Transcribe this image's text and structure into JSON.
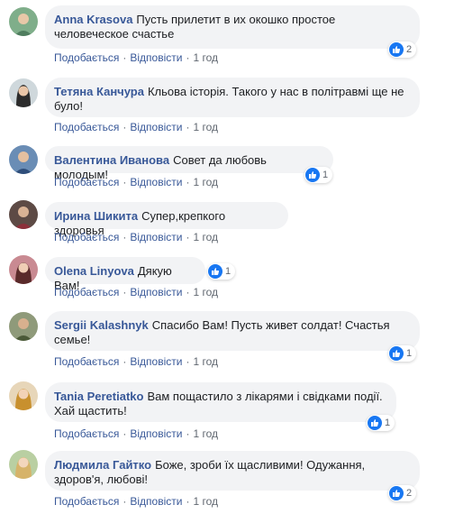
{
  "actions": {
    "like": "Подобається",
    "reply": "Відповісти",
    "separator": "·"
  },
  "colors": {
    "author": "#385898",
    "bubble": "#f2f3f5",
    "like": "#1877f2",
    "meta": "#606770"
  },
  "comments": [
    {
      "author": "Anna Krasova",
      "text": "Пусть прилетит в их окошко простое человеческое счастье",
      "time": "1 год",
      "likes": "2"
    },
    {
      "author": "Тетяна Канчура",
      "text": "Кльова історія. Такого у нас в політравмі ще не було!",
      "time": "1 год"
    },
    {
      "author": "Валентина Иванова",
      "text": "Совет да любовь молодым!",
      "time": "1 год",
      "likes": "1"
    },
    {
      "author": "Ирина Шикита",
      "text": "Супер,крепкого здоровья",
      "time": "1 год"
    },
    {
      "author": "Olena Linyova",
      "text": "Дякую Вам!",
      "time": "1 год",
      "likes": "1"
    },
    {
      "author": "Sergii Kalashnyk",
      "text": "Спасибо Вам! Пусть живет солдат! Счастья семье!",
      "time": "1 год",
      "likes": "1"
    },
    {
      "author": "Tania Peretiatko",
      "text": "Вам пощастило з лікарями і свідками події. Хай щастить!",
      "time": "1 год",
      "likes": "1"
    },
    {
      "author": "Людмила Гайтко",
      "text": "Боже, зроби їх щасливими! Одужання, здоров'я, любові!",
      "time": "1 год",
      "likes": "2"
    }
  ]
}
